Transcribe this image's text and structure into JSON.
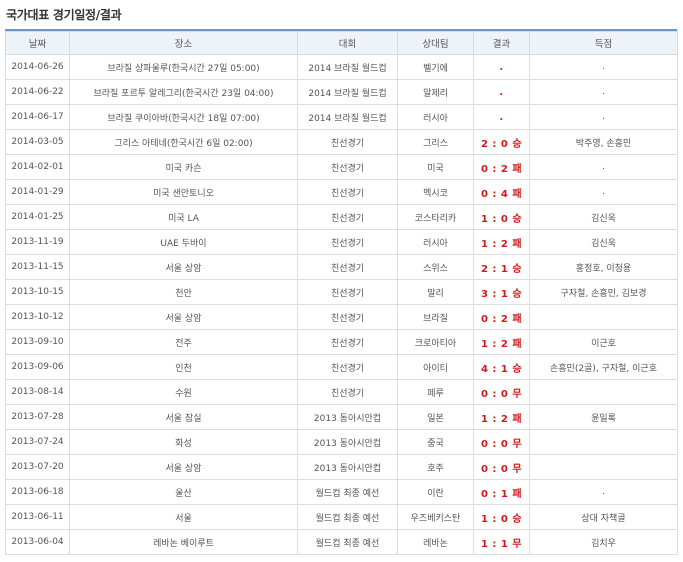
{
  "page": {
    "title": "국가대표 경기일정/결과"
  },
  "table": {
    "headers": [
      "날짜",
      "장소",
      "대회",
      "상대팀",
      "결과",
      "득점"
    ],
    "rows": [
      {
        "date": "2014-06-26",
        "venue": "브라질 상파울루(한국시간 27일 05:00)",
        "competition": "2014 브라질 월드컵",
        "opponent": "벨기에",
        "result": ".",
        "scorers": "."
      },
      {
        "date": "2014-06-22",
        "venue": "브라질 포르투 알레그리(한국시간 23일 04:00)",
        "competition": "2014 브라질 월드컵",
        "opponent": "알제리",
        "result": ".",
        "scorers": "."
      },
      {
        "date": "2014-06-17",
        "venue": "브라질 쿠이아바(한국시간 18일 07:00)",
        "competition": "2014 브라질 월드컵",
        "opponent": "러시아",
        "result": ".",
        "scorers": "."
      },
      {
        "date": "2014-03-05",
        "venue": "그리스 아테네(한국시간 6일 02:00)",
        "competition": "친선경기",
        "opponent": "그리스",
        "result": "2 : 0 승",
        "scorers": "박주영, 손흥민"
      },
      {
        "date": "2014-02-01",
        "venue": "미국 카슨",
        "competition": "친선경기",
        "opponent": "미국",
        "result": "0 : 2 패",
        "scorers": "."
      },
      {
        "date": "2014-01-29",
        "venue": "미국 샌안토니오",
        "competition": "친선경기",
        "opponent": "멕시코",
        "result": "0 : 4 패",
        "scorers": "."
      },
      {
        "date": "2014-01-25",
        "venue": "미국 LA",
        "competition": "친선경기",
        "opponent": "코스타리카",
        "result": "1 : 0 승",
        "scorers": "김신욱"
      },
      {
        "date": "2013-11-19",
        "venue": "UAE 두바이",
        "competition": "친선경기",
        "opponent": "러시아",
        "result": "1 : 2 패",
        "scorers": "김신욱"
      },
      {
        "date": "2013-11-15",
        "venue": "서울 상암",
        "competition": "친선경기",
        "opponent": "스위스",
        "result": "2 : 1 승",
        "scorers": "홍정호, 이청용"
      },
      {
        "date": "2013-10-15",
        "venue": "천안",
        "competition": "친선경기",
        "opponent": "말리",
        "result": "3 : 1 승",
        "scorers": "구자철, 손흥민, 김보경"
      },
      {
        "date": "2013-10-12",
        "venue": "서울 상암",
        "competition": "친선경기",
        "opponent": "브라질",
        "result": "0 : 2 패",
        "scorers": ""
      },
      {
        "date": "2013-09-10",
        "venue": "전주",
        "competition": "친선경기",
        "opponent": "크로아티아",
        "result": "1 : 2 패",
        "scorers": "이근호"
      },
      {
        "date": "2013-09-06",
        "venue": "인천",
        "competition": "친선경기",
        "opponent": "아이티",
        "result": "4 : 1 승",
        "scorers": "손흥민(2골), 구자철, 이근호"
      },
      {
        "date": "2013-08-14",
        "venue": "수원",
        "competition": "친선경기",
        "opponent": "페루",
        "result": "0 : 0 무",
        "scorers": ""
      },
      {
        "date": "2013-07-28",
        "venue": "서울 잠실",
        "competition": "2013 동아시안컵",
        "opponent": "일본",
        "result": "1 : 2 패",
        "scorers": "윤일록"
      },
      {
        "date": "2013-07-24",
        "venue": "화성",
        "competition": "2013 동아시안컵",
        "opponent": "중국",
        "result": "0 : 0 무",
        "scorers": ""
      },
      {
        "date": "2013-07-20",
        "venue": "서울 상암",
        "competition": "2013 동아시안컵",
        "opponent": "호주",
        "result": "0 : 0 무",
        "scorers": ""
      },
      {
        "date": "2013-06-18",
        "venue": "울산",
        "competition": "월드컵 최종 예선",
        "opponent": "이란",
        "result": "0 : 1 패",
        "scorers": "."
      },
      {
        "date": "2013-06-11",
        "venue": "서울",
        "competition": "월드컵 최종 예선",
        "opponent": "우즈베키스탄",
        "result": "1 : 0 승",
        "scorers": "상대 자책골"
      },
      {
        "date": "2013-06-04",
        "venue": "레바논 베이루트",
        "competition": "월드컵 최종 예선",
        "opponent": "레바논",
        "result": "1 : 1 무",
        "scorers": "김치우"
      }
    ]
  }
}
